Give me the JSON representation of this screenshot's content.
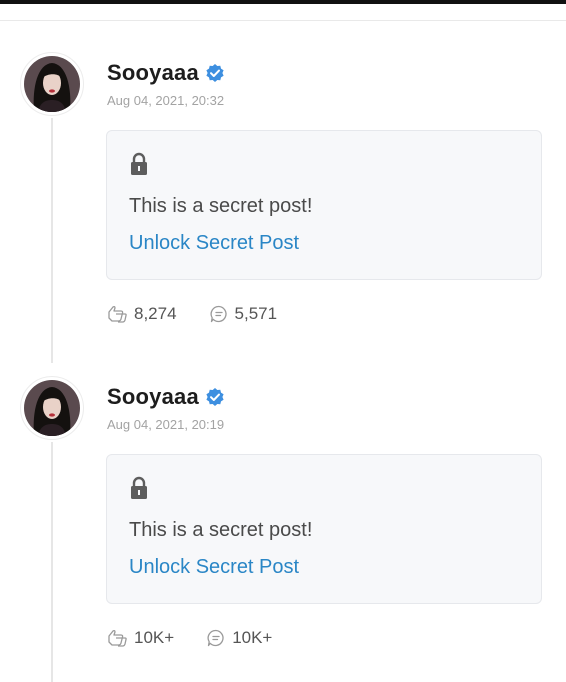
{
  "posts": [
    {
      "author": "Sooyaaa",
      "verified": true,
      "timestamp": "Aug 04, 2021, 20:32",
      "secret_text": "This is a secret post!",
      "unlock_label": "Unlock Secret Post",
      "likes": "8,274",
      "comments": "5,571"
    },
    {
      "author": "Sooyaaa",
      "verified": true,
      "timestamp": "Aug 04, 2021, 20:19",
      "secret_text": "This is a secret post!",
      "unlock_label": "Unlock Secret Post",
      "likes": "10K+",
      "comments": "10K+"
    }
  ],
  "icons": {
    "verified": "verified-check-icon",
    "lock": "lock-icon",
    "like": "like-icon",
    "comment": "comment-icon"
  },
  "colors": {
    "link": "#2a86c6",
    "verified_badge": "#3d8fe0",
    "timestamp": "#a3a3a3"
  }
}
